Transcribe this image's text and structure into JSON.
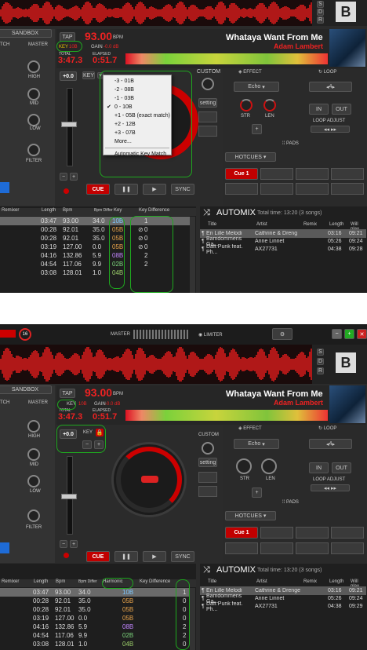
{
  "top_panel": {
    "deck": {
      "tap": "TAP",
      "bpm_value": "93.00",
      "bpm_unit": "BPM",
      "key_label": "KEY",
      "key_value": "10B",
      "gain_label": "GAIN",
      "gain_value": "-0.0 dB",
      "total_label": "TOTAL",
      "total_time": "3:47.3",
      "elapsed_label": "ELAPSED",
      "elapsed_time": "0:51.7",
      "title": "Whataya Want From Me",
      "artist": "Adam Lambert",
      "pitch": "+0.0",
      "key_button": "KEY",
      "custom": "CUSTOM",
      "setting": "setting",
      "effect": "EFFECT",
      "effect_name": "Echo",
      "str": "STR",
      "len": "LEN",
      "loop": "LOOP",
      "loop_value": "4",
      "in": "IN",
      "out": "OUT",
      "loop_adjust": "LOOP ADJUST",
      "pads": "PADS",
      "hotcues": "HOTCUES",
      "cue1": "Cue 1",
      "cue": "CUE",
      "sync": "SYNC",
      "sandbox": "SANDBOX",
      "master": "MASTER",
      "tch": "TCH",
      "high": "HIGH",
      "mid": "MID",
      "low": "LOW",
      "filter": "FILTER",
      "b": "B",
      "s": "S",
      "d": "D",
      "r": "R"
    },
    "key_menu": {
      "items": [
        "-3 - 01B",
        "-2 - 08B",
        "-1 - 03B",
        "0 - 10B",
        "+1 - 05B (exact match)",
        "+2 - 12B",
        "+3 - 07B",
        "More...",
        "Automatic Key Match"
      ],
      "checkmark": "✔"
    },
    "browser": {
      "headers": [
        "Remixer",
        "Length",
        "Bpm",
        "Bpm Differ",
        "Key",
        "Key Difference"
      ],
      "rows": [
        {
          "length": "03:47",
          "bpm": "93.00",
          "bpmdiff": "34.0",
          "key": "10B",
          "keydiff": "1",
          "icon": ""
        },
        {
          "length": "00:28",
          "bpm": "92.01",
          "bpmdiff": "35.0",
          "key": "05B",
          "keydiff": "0",
          "icon": "⊘"
        },
        {
          "length": "00:28",
          "bpm": "92.01",
          "bpmdiff": "35.0",
          "key": "05B",
          "keydiff": "0",
          "icon": "⊘"
        },
        {
          "length": "03:19",
          "bpm": "127.00",
          "bpmdiff": "0.0",
          "key": "05B",
          "keydiff": "0",
          "icon": "⊘"
        },
        {
          "length": "04:16",
          "bpm": "132.86",
          "bpmdiff": "5.9",
          "key": "08B",
          "keydiff": "2",
          "icon": ""
        },
        {
          "length": "04:54",
          "bpm": "117.06",
          "bpmdiff": "9.9",
          "key": "02B",
          "keydiff": "2",
          "icon": ""
        },
        {
          "length": "03:08",
          "bpm": "128.01",
          "bpmdiff": "1.0",
          "key": "04B",
          "keydiff": "",
          "icon": ""
        }
      ],
      "automix": "AUTOMIX",
      "automix_info": "Total time: 13:20 (3 songs)",
      "am_headers": [
        "Title",
        "Artist",
        "Remix",
        "Length",
        "Will play"
      ],
      "am_rows": [
        {
          "title": "En Lille Melodi",
          "artist": "Cathrine & Dreng",
          "length": "03:16",
          "play": "09:21"
        },
        {
          "title": "Bamdommens Ga...",
          "artist": "Anne Linnet",
          "length": "05:26",
          "play": "09:24"
        },
        {
          "title": "Daft Punk feat. Ph...",
          "artist": "AX27731",
          "length": "04:38",
          "play": "09:28"
        }
      ]
    }
  },
  "bottom_panel": {
    "topbar": {
      "badge": "16",
      "master": "MASTER",
      "limiter": "LIMITER",
      "gear": "⚙",
      "minus": "−",
      "plus": "+",
      "close": "✕"
    },
    "deck": {
      "tap": "TAP",
      "bpm_value": "93.00",
      "bpm_unit": "BPM",
      "key_label": "KEY",
      "key_value": "10B",
      "gain_label": "GAIN",
      "gain_value": "-0.0 dB",
      "total_label": "TOTAL",
      "total_time": "3:47.3",
      "elapsed_label": "ELAPSED",
      "elapsed_time": "0:51.7",
      "title": "Whataya Want From Me",
      "artist": "Adam Lambert",
      "pitch": "+0.0",
      "key_button": "KEY",
      "custom": "CUSTOM",
      "setting": "setting",
      "effect": "EFFECT",
      "effect_name": "Echo",
      "str": "STR",
      "len": "LEN",
      "loop": "LOOP",
      "loop_value": "4",
      "in": "IN",
      "out": "OUT",
      "loop_adjust": "LOOP ADJUST",
      "pads": "PADS",
      "hotcues": "HOTCUES",
      "cue1": "Cue 1",
      "cue": "CUE",
      "sync": "SYNC",
      "sandbox": "SANDBOX",
      "master": "MASTER",
      "tch": "TCH",
      "high": "HIGH",
      "mid": "MID",
      "low": "LOW",
      "filter": "FILTER",
      "b": "B",
      "s": "S",
      "d": "D",
      "r": "R"
    },
    "browser": {
      "headers": [
        "Remixer",
        "Length",
        "Bpm",
        "Bpm Differ",
        "Harmonic",
        "Key Difference"
      ],
      "rows": [
        {
          "length": "03:47",
          "bpm": "93.00",
          "bpmdiff": "34.0",
          "key": "10B",
          "keydiff": "1"
        },
        {
          "length": "00:28",
          "bpm": "92.01",
          "bpmdiff": "35.0",
          "key": "05B",
          "keydiff": "0"
        },
        {
          "length": "00:28",
          "bpm": "92.01",
          "bpmdiff": "35.0",
          "key": "05B",
          "keydiff": "0"
        },
        {
          "length": "03:19",
          "bpm": "127.00",
          "bpmdiff": "0.0",
          "key": "05B",
          "keydiff": "0"
        },
        {
          "length": "04:16",
          "bpm": "132.86",
          "bpmdiff": "5.9",
          "key": "08B",
          "keydiff": "2"
        },
        {
          "length": "04:54",
          "bpm": "117.06",
          "bpmdiff": "9.9",
          "key": "02B",
          "keydiff": "2"
        },
        {
          "length": "03:08",
          "bpm": "128.01",
          "bpmdiff": "1.0",
          "key": "04B",
          "keydiff": "0"
        }
      ],
      "automix": "AUTOMIX",
      "automix_info": "Total time: 13:20 (3 songs)",
      "am_headers": [
        "Title",
        "Artist",
        "Remix",
        "Length",
        "Will play"
      ],
      "am_rows": [
        {
          "title": "En Lille Melodi",
          "artist": "Cathrine & Drenge",
          "length": "03:16",
          "play": "09:21"
        },
        {
          "title": "Bamdommens Ga...",
          "artist": "Anne Linnet",
          "length": "05:26",
          "play": "09:24"
        },
        {
          "title": "Daft Punk feat. Ph...",
          "artist": "AX27731",
          "length": "04:38",
          "play": "09:29"
        }
      ]
    }
  }
}
